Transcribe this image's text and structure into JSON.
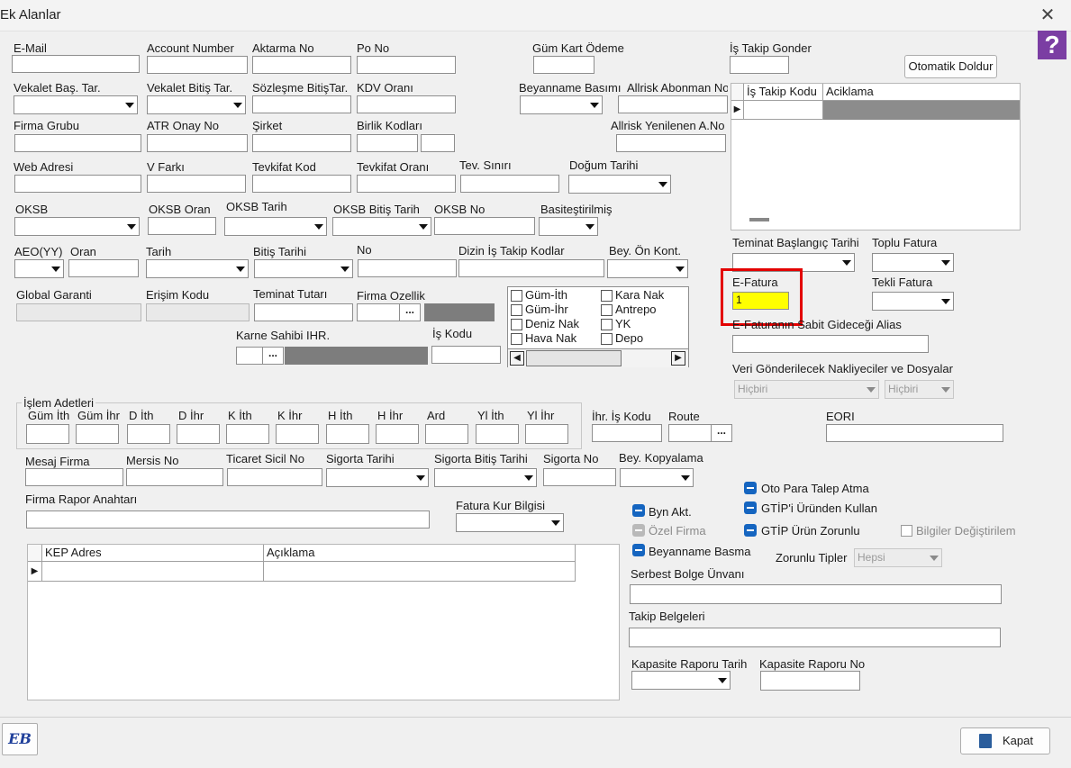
{
  "window": {
    "title": "Ek Alanlar"
  },
  "labels": {
    "email": "E-Mail",
    "account_number": "Account Number",
    "aktarma_no": "Aktarma No",
    "po_no": "Po No",
    "gum_kart_odeme": "Güm Kart Ödeme",
    "is_takip_gonder": "İş Takip Gonder",
    "vekalet_bas": "Vekalet Baş. Tar.",
    "vekalet_bitis": "Vekalet Bitiş Tar.",
    "sozlesme_bitis": "Sözleşme BitişTar.",
    "kdv_orani": "KDV Oranı",
    "beyanname_basim": "Beyanname Basımı",
    "allrisk_abonman": "Allrisk Abonman No",
    "firma_grubu": "Firma Grubu",
    "atr_onay": "ATR Onay No",
    "sirket": "Şirket",
    "birlik_kodlari": "Birlik Kodları",
    "allrisk_yenilenen": "Allrisk Yenilenen A.No",
    "web_adresi": "Web Adresi",
    "v_farki": "V Farkı",
    "tevkifat_kod": "Tevkifat Kod",
    "tevkifat_orani": "Tevkifat Oranı",
    "tev_siniri": "Tev. Sınırı",
    "dogum_tarihi": "Doğum Tarihi",
    "oksb": "OKSB",
    "oksb_oran": "OKSB Oran",
    "oksb_tarih": "OKSB Tarih",
    "oksb_bitis": "OKSB Bitiş Tarih",
    "oksb_no": "OKSB No",
    "basitestirilmis": "Basiteştirilmiş",
    "aeo": "AEO(YY)",
    "oran": "Oran",
    "tarih": "Tarih",
    "bitis_tarihi": "Bitiş Tarihi",
    "no": "No",
    "dizin": "Dizin İş Takip Kodlar",
    "bey_on_kont": "Bey. Ön Kont.",
    "global_garanti": "Global Garanti",
    "erisim_kodu": "Erişim Kodu",
    "teminat_tutari": "Teminat Tutarı",
    "firma_ozellik": "Firma Ozellik",
    "karne_sahibi": "Karne Sahibi IHR.",
    "is_kodu": "İş Kodu",
    "teminat_baslangic": "Teminat Başlangıç Tarihi",
    "toplu_fatura": "Toplu Fatura",
    "e_fatura": "E-Fatura",
    "tekli_fatura": "Tekli Fatura",
    "efatura_alias": "E-Faturanın Sabit Gideceği Alias",
    "veri_gonderilecek": "Veri Gönderilecek Nakliyeciler ve Dosyalar",
    "islem_adetleri": "İşlem Adetleri",
    "ihr_is_kodu": "İhr. İş Kodu",
    "route": "Route",
    "eori": "EORI",
    "mesaj_firma": "Mesaj Firma",
    "mersis_no": "Mersis No",
    "ticaret_sicil": "Ticaret Sicil No",
    "sigorta_tarihi": "Sigorta Tarihi",
    "sigorta_bitis": "Sigorta Bitiş Tarihi",
    "sigorta_no": "Sigorta No",
    "bey_kopyalama": "Bey. Kopyalama",
    "firma_rapor": "Firma Rapor Anahtarı",
    "fatura_kur": "Fatura Kur Bilgisi",
    "serbest_bolge": "Serbest Bolge Ünvanı",
    "takip_belgeleri": "Takip Belgeleri",
    "kapasite_tarih": "Kapasite Raporu Tarih",
    "kapasite_no": "Kapasite Raporu No",
    "zorunlu_tipler": "Zorunlu Tipler"
  },
  "islem_columns": [
    "Güm İth",
    "Güm İhr",
    "D İth",
    "D İhr",
    "K İth",
    "K İhr",
    "H İth",
    "H İhr",
    "Ard",
    "Yl İth",
    "Yl İhr"
  ],
  "values": {
    "e_fatura": "1"
  },
  "combos": {
    "veri1": "Hiçbiri",
    "veri2": "Hiçbiri",
    "zorunlu": "Hepsi"
  },
  "transport_checks": [
    "Güm-İth",
    "Kara Nak",
    "Güm-İhr",
    "Antrepo",
    "Deniz Nak",
    "YK",
    "Hava Nak",
    "Depo"
  ],
  "options": {
    "oto_para": "Oto Para Talep Atma",
    "gtip_urun": "GTİP'i Üründen Kullan",
    "gtip_zorunlu": "GTİP Ürün Zorunlu",
    "bilgiler": "Bilgiler Değiştirilem",
    "byn_akt": "Byn Akt.",
    "ozel_firma": "Özel Firma",
    "beyanname_basma": "Beyanname Basma"
  },
  "is_takip_grid": {
    "columns": [
      "İş Takip Kodu",
      "Aciklama"
    ]
  },
  "kep_grid": {
    "columns": [
      "KEP Adres",
      "Açıklama"
    ]
  },
  "buttons": {
    "otomatik": "Otomatik Doldur",
    "kapat": "Kapat",
    "ellipsis": "...",
    "logo": "EB",
    "help": "?"
  },
  "colors": {
    "highlight": "#ffff00",
    "accent_box": "#e30000",
    "checkbox_blue": "#1565c0",
    "help_purple": "#7b3ea3"
  }
}
